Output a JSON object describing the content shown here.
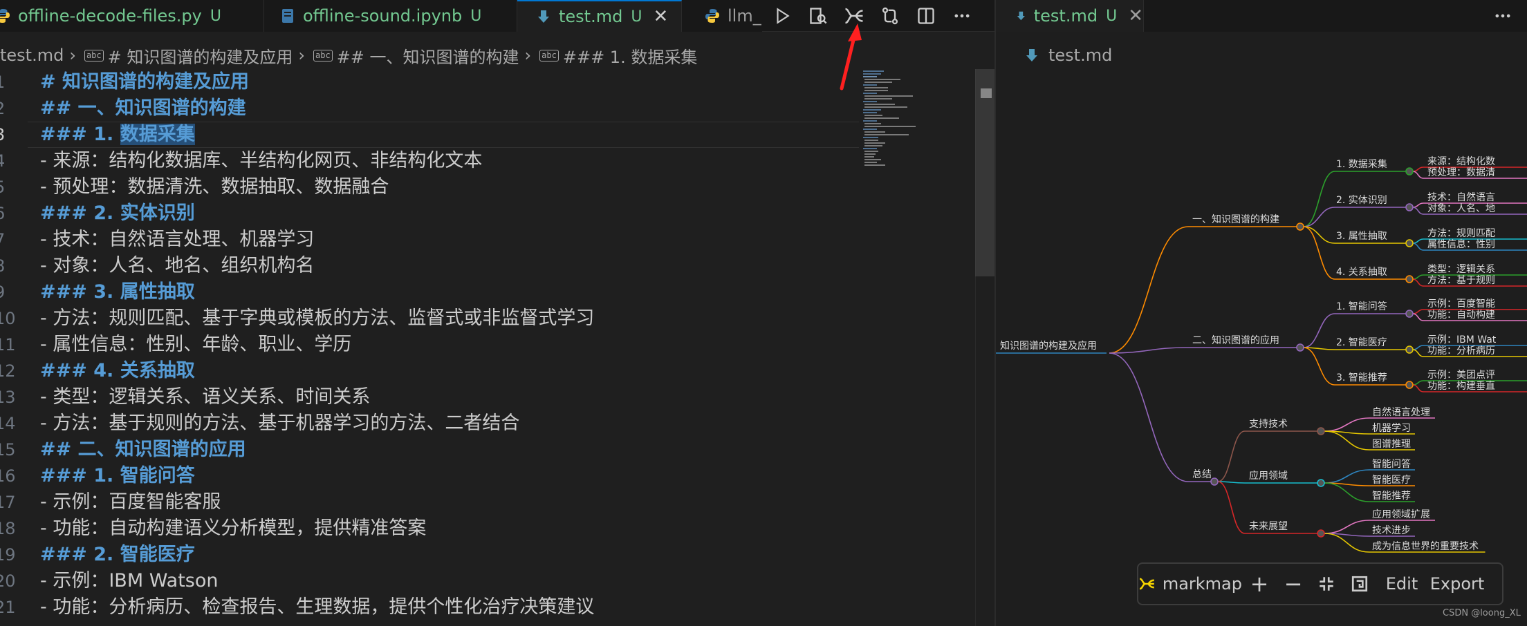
{
  "tabs": [
    {
      "name": "offline-decode-files.py",
      "status": "U"
    },
    {
      "name": "offline-sound.ipynb",
      "status": "U"
    },
    {
      "name": "test.md",
      "status": "U"
    },
    {
      "name": "llm_"
    }
  ],
  "breadcrumb": {
    "file": "test.md",
    "items": [
      "# 知识图谱的构建及应用",
      "## 一、知识图谱的构建",
      "### 1. 数据采集"
    ],
    "abc": "abc"
  },
  "editor": {
    "lines": [
      {
        "n": "1",
        "text": "# 知识图谱的构建及应用",
        "kind": "h"
      },
      {
        "n": "2",
        "text": "## 一、知识图谱的构建",
        "kind": "h"
      },
      {
        "n": "3",
        "prefix": "### 1. ",
        "selected": "数据采集",
        "kind": "h"
      },
      {
        "n": "4",
        "marker": "- ",
        "text": "来源：结构化数据库、半结构化网页、非结构化文本",
        "kind": "li"
      },
      {
        "n": "5",
        "marker": "- ",
        "text": "预处理：数据清洗、数据抽取、数据融合",
        "kind": "li"
      },
      {
        "n": "6",
        "text": "### 2. 实体识别",
        "kind": "h"
      },
      {
        "n": "7",
        "marker": "- ",
        "text": "技术：自然语言处理、机器学习",
        "kind": "li"
      },
      {
        "n": "8",
        "marker": "- ",
        "text": "对象：人名、地名、组织机构名",
        "kind": "li"
      },
      {
        "n": "9",
        "text": "### 3. 属性抽取",
        "kind": "h"
      },
      {
        "n": "10",
        "marker": "- ",
        "text": "方法：规则匹配、基于字典或模板的方法、监督式或非监督式学习",
        "kind": "li"
      },
      {
        "n": "11",
        "marker": "- ",
        "text": "属性信息：性别、年龄、职业、学历",
        "kind": "li"
      },
      {
        "n": "12",
        "text": "### 4. 关系抽取",
        "kind": "h"
      },
      {
        "n": "13",
        "marker": "- ",
        "text": "类型：逻辑关系、语义关系、时间关系",
        "kind": "li"
      },
      {
        "n": "14",
        "marker": "- ",
        "text": "方法：基于规则的方法、基于机器学习的方法、二者结合",
        "kind": "li"
      },
      {
        "n": "15",
        "text": "## 二、知识图谱的应用",
        "kind": "h"
      },
      {
        "n": "16",
        "text": "### 1. 智能问答",
        "kind": "h"
      },
      {
        "n": "17",
        "marker": "- ",
        "text": "示例：百度智能客服",
        "kind": "li"
      },
      {
        "n": "18",
        "marker": "- ",
        "text": "功能：自动构建语义分析模型，提供精准答案",
        "kind": "li"
      },
      {
        "n": "19",
        "text": "### 2. 智能医疗",
        "kind": "h"
      },
      {
        "n": "20",
        "marker": "- ",
        "text": "示例：IBM Watson",
        "kind": "li"
      },
      {
        "n": "21",
        "marker": "- ",
        "text": "功能：分析病历、检查报告、生理数据，提供个性化治疗决策建议",
        "kind": "li"
      }
    ]
  },
  "right": {
    "tab": {
      "name": "test.md",
      "status": "U"
    },
    "breadcrumb": "test.md"
  },
  "mindmap": {
    "root": "知识图谱的构建及应用",
    "branch1": {
      "label": "一、知识图谱的构建",
      "children": [
        {
          "label": "1. 数据采集",
          "leaves": [
            "来源：结构化数",
            "预处理：数据清"
          ]
        },
        {
          "label": "2. 实体识别",
          "leaves": [
            "技术：自然语言",
            "对象：人名、地"
          ]
        },
        {
          "label": "3. 属性抽取",
          "leaves": [
            "方法：规则匹配",
            "属性信息：性别"
          ]
        },
        {
          "label": "4. 关系抽取",
          "leaves": [
            "类型：逻辑关系",
            "方法：基于规则"
          ]
        }
      ]
    },
    "branch2": {
      "label": "二、知识图谱的应用",
      "children": [
        {
          "label": "1. 智能问答",
          "leaves": [
            "示例：百度智能",
            "功能：自动构建"
          ]
        },
        {
          "label": "2. 智能医疗",
          "leaves": [
            "示例：IBM Wat",
            "功能：分析病历"
          ]
        },
        {
          "label": "3. 智能推荐",
          "leaves": [
            "示例：美团点评",
            "功能：构建垂直"
          ]
        }
      ]
    },
    "branch3": {
      "label": "总结",
      "children": [
        {
          "label": "支持技术",
          "leaves": [
            "自然语言处理",
            "机器学习",
            "图谱推理"
          ]
        },
        {
          "label": "应用领域",
          "leaves": [
            "智能问答",
            "智能医疗",
            "智能推荐"
          ]
        },
        {
          "label": "未来展望",
          "leaves": [
            "应用领域扩展",
            "技术进步",
            "成为信息世界的重要技术"
          ]
        }
      ]
    }
  },
  "markmap_toolbar": {
    "brand": "markmap",
    "zoom_in": "+",
    "zoom_out": "−",
    "edit": "Edit",
    "export": "Export"
  },
  "credit": "CSDN @loong_XL",
  "colors": {
    "accent": "#0078d4",
    "heading": "#569cd6",
    "untracked": "#73c991",
    "annotation_arrow": "#ff2020",
    "markmap_logo": "#f5d400"
  }
}
